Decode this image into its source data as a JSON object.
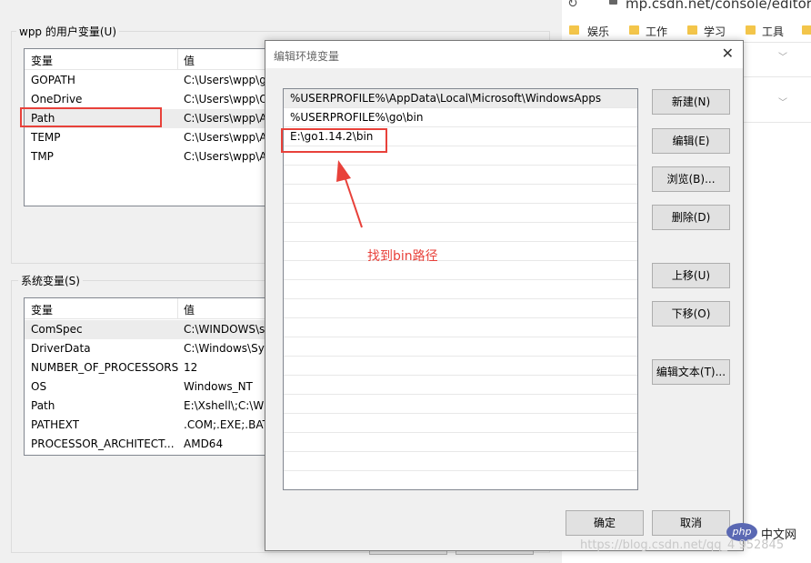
{
  "background_dialog": {
    "user_vars": {
      "title": "wpp 的用户变量(U)",
      "col_var": "变量",
      "col_val": "值",
      "rows": [
        {
          "name": "GOPATH",
          "value": "C:\\Users\\wpp\\g"
        },
        {
          "name": "OneDrive",
          "value": "C:\\Users\\wpp\\O"
        },
        {
          "name": "Path",
          "value": "C:\\Users\\wpp\\A"
        },
        {
          "name": "TEMP",
          "value": "C:\\Users\\wpp\\A"
        },
        {
          "name": "TMP",
          "value": "C:\\Users\\wpp\\A"
        }
      ]
    },
    "system_vars": {
      "title": "系统变量(S)",
      "col_var": "变量",
      "col_val": "值",
      "rows": [
        {
          "name": "ComSpec",
          "value": "C:\\WINDOWS\\s"
        },
        {
          "name": "DriverData",
          "value": "C:\\Windows\\Sys"
        },
        {
          "name": "NUMBER_OF_PROCESSORS",
          "value": "12"
        },
        {
          "name": "OS",
          "value": "Windows_NT"
        },
        {
          "name": "Path",
          "value": "E:\\Xshell\\;C:\\WI"
        },
        {
          "name": "PATHEXT",
          "value": ".COM;.EXE;.BAT"
        },
        {
          "name": "PROCESSOR_ARCHITECT...",
          "value": "AMD64"
        }
      ]
    }
  },
  "browser": {
    "url": "mp.csdn.net/console/editor/ht",
    "bookmarks": [
      "娱乐",
      "工作",
      "学习",
      "工具"
    ]
  },
  "edit_dialog": {
    "title": "编辑环境变量",
    "paths": [
      "%USERPROFILE%\\AppData\\Local\\Microsoft\\WindowsApps",
      "%USERPROFILE%\\go\\bin",
      "E:\\go1.14.2\\bin"
    ],
    "buttons": {
      "new": "新建(N)",
      "edit": "编辑(E)",
      "browse": "浏览(B)...",
      "delete": "删除(D)",
      "move_up": "上移(U)",
      "move_down": "下移(O)",
      "edit_text": "编辑文本(T)...",
      "ok": "确定",
      "cancel": "取消"
    }
  },
  "annotation": {
    "text": "找到bin路径",
    "color": "#e8413a"
  },
  "watermark": {
    "logo": "php",
    "cn": "中文网",
    "url": "https://blog.csdn.net/qq_4       952845"
  }
}
